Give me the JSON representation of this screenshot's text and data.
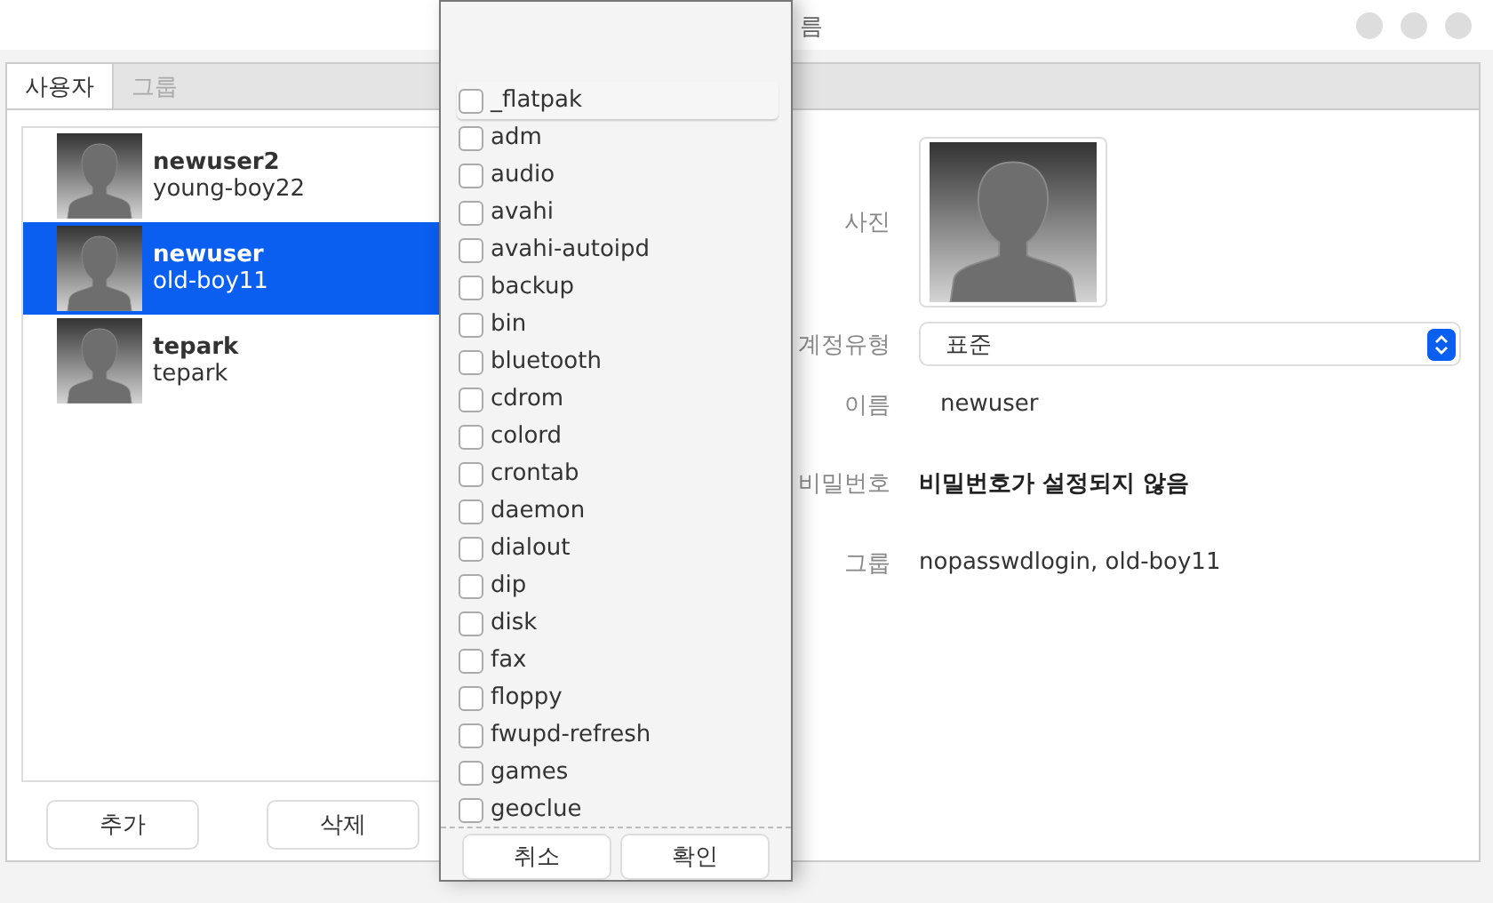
{
  "window": {
    "title": "름"
  },
  "tabs": [
    {
      "label": "사용자",
      "selected": true
    },
    {
      "label": "그룹",
      "selected": false
    }
  ],
  "users": [
    {
      "name": "newuser2",
      "group": "young-boy22",
      "selected": false
    },
    {
      "name": "newuser",
      "group": "old-boy11",
      "selected": true
    },
    {
      "name": "tepark",
      "group": "tepark",
      "selected": false
    }
  ],
  "buttons": [
    "추가",
    "삭제"
  ],
  "details": {
    "photo_label": "사진",
    "account_type_label": "계정유형",
    "account_type": "표준",
    "name_label": "이름",
    "name": "newuser",
    "password_label": "비밀번호",
    "password": "비밀번호가 설정되지 않음",
    "groups_label": "그룹",
    "groups": "nopasswdlogin, old-boy11"
  },
  "group_popup": {
    "items": [
      {
        "label": "_flatpak",
        "checked": false,
        "selected": true
      },
      {
        "label": "adm",
        "checked": false,
        "selected": false
      },
      {
        "label": "audio",
        "checked": false,
        "selected": false
      },
      {
        "label": "avahi",
        "checked": false,
        "selected": false
      },
      {
        "label": "avahi-autoipd",
        "checked": false,
        "selected": false
      },
      {
        "label": "backup",
        "checked": false,
        "selected": false
      },
      {
        "label": "bin",
        "checked": false,
        "selected": false
      },
      {
        "label": "bluetooth",
        "checked": false,
        "selected": false
      },
      {
        "label": "cdrom",
        "checked": false,
        "selected": false
      },
      {
        "label": "colord",
        "checked": false,
        "selected": false
      },
      {
        "label": "crontab",
        "checked": false,
        "selected": false
      },
      {
        "label": "daemon",
        "checked": false,
        "selected": false
      },
      {
        "label": "dialout",
        "checked": false,
        "selected": false
      },
      {
        "label": "dip",
        "checked": false,
        "selected": false
      },
      {
        "label": "disk",
        "checked": false,
        "selected": false
      },
      {
        "label": "fax",
        "checked": false,
        "selected": false
      },
      {
        "label": "floppy",
        "checked": false,
        "selected": false
      },
      {
        "label": "fwupd-refresh",
        "checked": false,
        "selected": false
      },
      {
        "label": "games",
        "checked": false,
        "selected": false
      },
      {
        "label": "geoclue",
        "checked": false,
        "selected": false
      }
    ],
    "buttons": [
      "취소",
      "확인"
    ]
  }
}
